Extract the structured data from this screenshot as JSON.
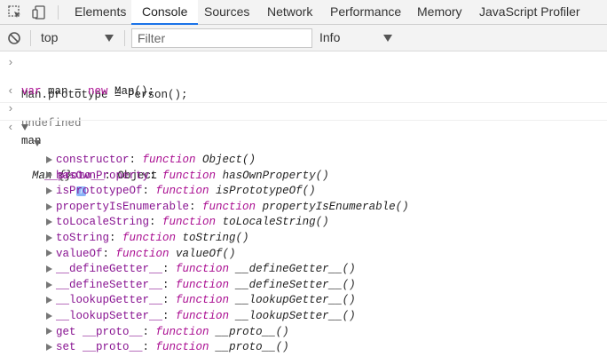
{
  "tabs": [
    "Elements",
    "Console",
    "Sources",
    "Network",
    "Performance",
    "Memory",
    "JavaScript Profiler"
  ],
  "active_tab": "Console",
  "toolbar": {
    "context": "top",
    "filter_placeholder": "Filter",
    "levels": "Info"
  },
  "console": {
    "input1_line1": "Man.prototype = Person();",
    "input1_line2_kw": "var",
    "input1_line2_rest": " man = ",
    "input1_line2_new": "new",
    "input1_line2_end": " Man();",
    "result1": "undefined",
    "input2": "man",
    "result2_name": "Man {}",
    "info_badge": "i",
    "proto_key": "__proto__",
    "proto_value": ": Object",
    "props": [
      {
        "key": "constructor",
        "sep": ": ",
        "kw": "function",
        "name": " Object()"
      },
      {
        "key": "hasOwnProperty",
        "sep": ": ",
        "kw": "function",
        "name": " hasOwnProperty()"
      },
      {
        "key": "isPrototypeOf",
        "sep": ": ",
        "kw": "function",
        "name": " isPrototypeOf()"
      },
      {
        "key": "propertyIsEnumerable",
        "sep": ": ",
        "kw": "function",
        "name": " propertyIsEnumerable()"
      },
      {
        "key": "toLocaleString",
        "sep": ": ",
        "kw": "function",
        "name": " toLocaleString()"
      },
      {
        "key": "toString",
        "sep": ": ",
        "kw": "function",
        "name": " toString()"
      },
      {
        "key": "valueOf",
        "sep": ": ",
        "kw": "function",
        "name": " valueOf()"
      },
      {
        "key": "__defineGetter__",
        "sep": ": ",
        "kw": "function",
        "name": " __defineGetter__()"
      },
      {
        "key": "__defineSetter__",
        "sep": ": ",
        "kw": "function",
        "name": " __defineSetter__()"
      },
      {
        "key": "__lookupGetter__",
        "sep": ": ",
        "kw": "function",
        "name": " __lookupGetter__()"
      },
      {
        "key": "__lookupSetter__",
        "sep": ": ",
        "kw": "function",
        "name": " __lookupSetter__()"
      },
      {
        "key": "get __proto__",
        "sep": ": ",
        "kw": "function",
        "name": " __proto__()"
      },
      {
        "key": "set __proto__",
        "sep": ": ",
        "kw": "function",
        "name": " __proto__()"
      }
    ]
  },
  "icons": {
    "inspect": "inspect-element-icon",
    "device": "device-toolbar-icon",
    "clear": "clear-console-icon"
  },
  "colors": {
    "keyword": "#aa0d91",
    "property": "#881391",
    "active_tab_underline": "#1a73e8"
  }
}
